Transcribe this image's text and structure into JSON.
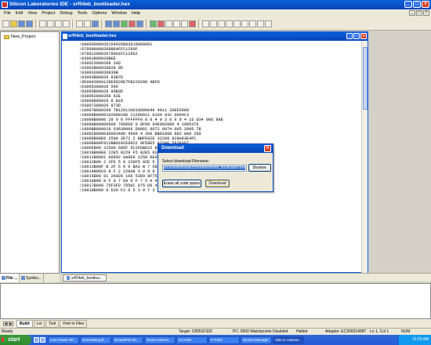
{
  "app": {
    "title": "Silicon Laboratories IDE - srf04eb_bootloader.hex"
  },
  "menu": {
    "items": [
      "File",
      "Edit",
      "View",
      "Project",
      "Debug",
      "Tools",
      "Options",
      "Window",
      "Help"
    ]
  },
  "left_pane": {
    "project_item": "New_Project",
    "tabs": [
      "File ...",
      "Symbo..."
    ]
  },
  "editor": {
    "title": "srf04eb_bootloader.hex",
    "tab_label": "srf04eb_bootloa...",
    "lines": [
      ":0A000000020154020803010000091",
      ":070008000208B84FFC1260F",
      ":0700130002078001FC12662",
      ":03001B00020BEE",
      ":030023000208 2AD",
      ":03002B00020828 9D",
      ":03003300020839B",
      ":03003B00020 83B7D",
      ":0E004300A128E9620E7FB220208 4BFD",
      ":03005300020 54D",
      ":03005B00020 85B3D",
      ":030063000208 62E",
      ":03006B00020 8 B1D",
      ":03007300020 873D",
      ":10007B000208 7B120110010000040 4011 20EE5080",
      ":10008B0000102000190 21200011 0104 032 0904C3",
      ":10009B0000 20 0 0 FFFFFF0 0 0 4 0 3 0 9 0 4 16 034 006 888",
      ":1000AB00006900 700060 0 6F00 64E002000 4 1005376",
      ":1000BB000018 03630006 D0061 0072 0074 005 2006 7B",
      ":1000CB000030003400 4500 4 200 BB01068 982 8A9 260",
      ":1000DB00E0 2500 2E72 2 BBFE02E 32289 828A83E4FC",
      ":1000EB00F912BB010CE8922 9F58E5 833AF 583E087",
      ":1000FB00 22500 685F 5C2FEB622 BBFF 6E 4 2 8E4A1",
      ":10010B00E0 22E5 8229 F5 82E5 833 4 0 0F583E0",
      ":10011B0001 06892 8A9E0 2250 0E0E0 F",
      ":10012B00 2 2FE 5 8 229F5 82E 5 8 334 00F",
      ":10013B00F B 2F 5 0 0 BA3 B 7 582 C 8 F5 8",
      ":10014B00C0 8 F 2 228A8 3 0 9 8 2 E4 7 3 D 0 7",
      ":10015B00 81 2A020 160 53D9 8F75 E 1 0",
      ":10016B00 8 F 8 7 6A 0 F 7 5 A 4 1 D 7 5 A 6 9 8 7",
      ":10017B000 75F3FD 75D6C 075 D6 4C 75 D",
      ":10018B000 9 D2A F2 0 5 3 0 7 3 0 9 5 0 4 7 F 0"
    ]
  },
  "dialog": {
    "title": "Download",
    "label": "Select download Filename:",
    "filename": "ocuments\\Eetas\\Ctr04eb\\srf04eb_bootloader.hex",
    "browse_label": "Browse",
    "erase_label": "Erase all code space",
    "download_label": "Download"
  },
  "output": {
    "tabs": [
      "Build",
      "Lst",
      "Tool",
      "Find in Files"
    ]
  },
  "status": {
    "ready": "Ready",
    "target": "Target: C8051F320",
    "pc": "PC: 0000 Watchpoints Disabled",
    "state": "Halted",
    "adapter": "Adapter: EC300014987",
    "position": "Ln 1, Col 1",
    "num": "NUM"
  },
  "taskbar": {
    "start_label": "start",
    "buttons": [
      "Lion Power RP...",
      "simo106a.pdf...",
      "SmartRFB Str...",
      "Texas Instrum...",
      "CCxx00",
      "P-Paint",
      "Device Manager",
      "Silicon Laborat..."
    ],
    "clock": "12:29 AM"
  }
}
